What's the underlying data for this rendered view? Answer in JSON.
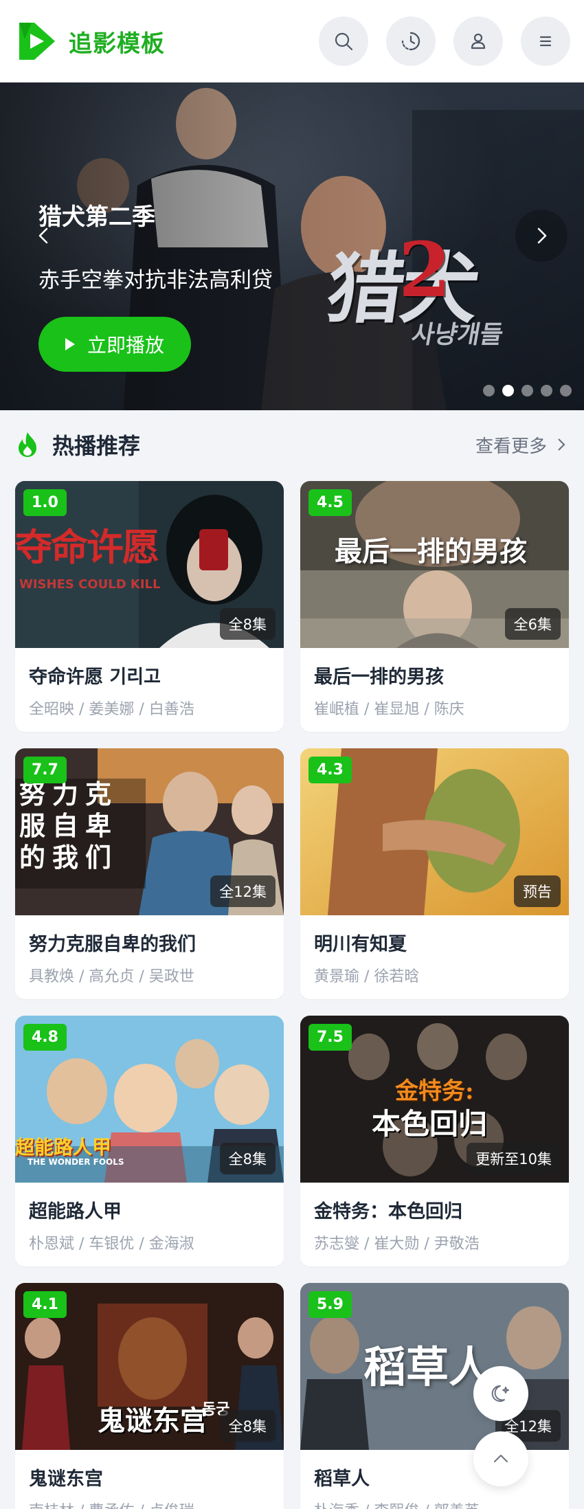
{
  "brand": {
    "name": "追影模板",
    "logo_icon": "play-triangle-logo",
    "color": "#1fae21"
  },
  "header": {
    "buttons": [
      {
        "name": "search-icon"
      },
      {
        "name": "history-icon"
      },
      {
        "name": "user-icon"
      },
      {
        "name": "menu-icon"
      }
    ]
  },
  "banner": {
    "title": "猎犬第二季",
    "subtitle": "赤手空拳对抗非法高利贷",
    "play_label": "立即播放",
    "poster_text_main": "猎犬",
    "poster_text_number": "2",
    "poster_text_korean": "사냥개들",
    "slide_count": 5,
    "active_slide": 2
  },
  "section": {
    "title": "热播推荐",
    "more_label": "查看更多",
    "accent": "#19c119"
  },
  "cards": [
    {
      "title": "夺命许愿 기리고",
      "cast": "全昭映 / 姜美娜 / 白善浩",
      "score": "1.0",
      "episodes": "全8集",
      "poster_text": "夺命许愿",
      "poster_sub": "WISHES COULD KILL"
    },
    {
      "title": "最后一排的男孩",
      "cast": "崔岷植 / 崔显旭 / 陈庆",
      "score": "4.5",
      "episodes": "全6集",
      "poster_text": "最后一排的男孩"
    },
    {
      "title": "努力克服自卑的我们",
      "cast": "具教焕 / 高允贞 / 吴政世",
      "score": "7.7",
      "episodes": "全12集",
      "poster_text": "努力克服自卑的我们"
    },
    {
      "title": "明川有知夏",
      "cast": "黄景瑜 / 徐若晗",
      "score": "4.3",
      "episodes": "预告"
    },
    {
      "title": "超能路人甲",
      "cast": "朴恩斌 / 车银优 / 金海淑",
      "score": "4.8",
      "episodes": "全8集",
      "poster_text": "超能路人甲",
      "poster_sub": "THE WONDER FOOLS"
    },
    {
      "title": "金特务：本色回归",
      "cast": "苏志燮 / 崔大勋 / 尹敬浩",
      "score": "7.5",
      "episodes": "更新至10集",
      "poster_text": "金特务:",
      "poster_text_2": "本色回归"
    },
    {
      "title": "鬼谜东宫",
      "cast": "南枝林 / 曹承佑 / 卢俊瑞",
      "score": "4.1",
      "episodes": "全8集",
      "poster_text": "鬼谜东宫",
      "poster_text_2": "동궁"
    },
    {
      "title": "稻草人",
      "cast": "朴海秀 / 李熙俊 / 郭善英",
      "score": "5.9",
      "episodes": "全12集",
      "poster_text": "稻草人"
    }
  ],
  "floating": {
    "theme_icon": "moon-stars-icon",
    "top_icon": "chevron-up-icon"
  }
}
